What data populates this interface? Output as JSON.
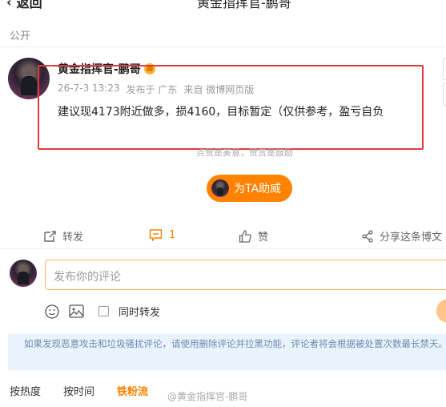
{
  "header": {
    "back_label": "返回",
    "title": "黄金指挥官-鹏哥"
  },
  "visibility": "公开",
  "post": {
    "author": "黄金指挥官-鹏哥",
    "time": "26-7-3 13:23",
    "location": "发布于 广东",
    "source": "来自 微博网页版",
    "content": "建议现4173附近做多，损4160，目标暂定（仅供参考，盈亏自负",
    "hint": "点赞是美意，赞赏是鼓励",
    "cheer_label": "为TA助威"
  },
  "actions": {
    "repost_label": "转发",
    "comment_count": "1",
    "like_label": "赞",
    "share_label": "分享这条博文"
  },
  "comment_box": {
    "placeholder": "发布你的评论",
    "repost_checkbox_label": "同时转发"
  },
  "notice": "如果发现恶意攻击和垃圾骚扰评论，请使用删除评论并拉黑功能，评论者将会根据被处置次数最长禁天。",
  "sort_tabs": [
    "按热度",
    "按时间",
    "铁粉流"
  ],
  "watermark": "@黄金指挥官-鹏哥",
  "colors": {
    "accent": "#ff8200",
    "highlight_box": "#e23b3b",
    "notice_bg": "#e8f3fc"
  }
}
